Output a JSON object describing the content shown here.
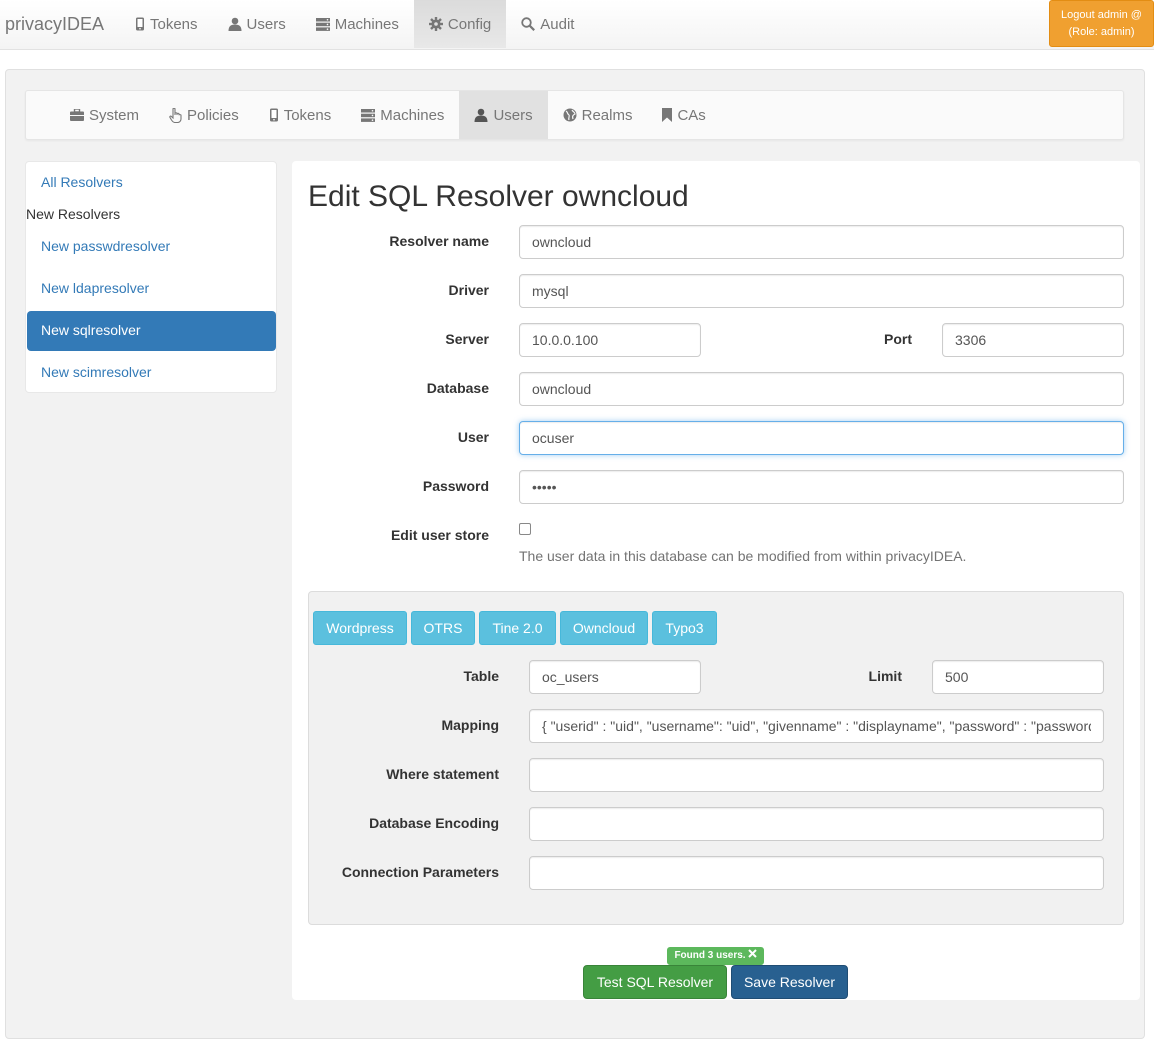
{
  "app": {
    "brand": "privacyIDEA"
  },
  "topnav": {
    "items": [
      {
        "label": "Tokens",
        "icon": "phone-icon"
      },
      {
        "label": "Users",
        "icon": "user-icon"
      },
      {
        "label": "Machines",
        "icon": "server-icon"
      },
      {
        "label": "Config",
        "icon": "gear-icon",
        "active": true
      },
      {
        "label": "Audit",
        "icon": "search-icon"
      }
    ],
    "logout_line1": "Logout admin @",
    "logout_line2": "(Role: admin)"
  },
  "subnav": {
    "items": [
      {
        "label": "System",
        "icon": "briefcase-icon"
      },
      {
        "label": "Policies",
        "icon": "hand-pointer-icon"
      },
      {
        "label": "Tokens",
        "icon": "phone-icon"
      },
      {
        "label": "Machines",
        "icon": "server-icon"
      },
      {
        "label": "Users",
        "icon": "user-icon",
        "active": true
      },
      {
        "label": "Realms",
        "icon": "globe-icon"
      },
      {
        "label": "CAs",
        "icon": "bookmark-icon"
      }
    ]
  },
  "sidebar": {
    "all_resolvers": "All Resolvers",
    "new_heading": "New Resolvers",
    "items": [
      "New passwdresolver",
      "New ldapresolver",
      "New sqlresolver",
      "New scimresolver"
    ],
    "active_index": 2
  },
  "form": {
    "title": "Edit SQL Resolver owncloud",
    "labels": {
      "resolver_name": "Resolver name",
      "driver": "Driver",
      "server": "Server",
      "port": "Port",
      "database": "Database",
      "user": "User",
      "password": "Password",
      "edit_user_store": "Edit user store"
    },
    "values": {
      "resolver_name": "owncloud",
      "driver": "mysql",
      "server": "10.0.0.100",
      "port": "3306",
      "database": "owncloud",
      "user": "ocuser",
      "password": "•••••"
    },
    "edit_user_store_checked": false,
    "edit_user_store_help": "The user data in this database can be modified from within privacyIDEA."
  },
  "presets": [
    "Wordpress",
    "OTRS",
    "Tine 2.0",
    "Owncloud",
    "Typo3"
  ],
  "advanced": {
    "labels": {
      "table": "Table",
      "limit": "Limit",
      "mapping": "Mapping",
      "where": "Where statement",
      "encoding": "Database Encoding",
      "conn_params": "Connection Parameters"
    },
    "values": {
      "table": "oc_users",
      "limit": "500",
      "mapping": "{ \"userid\" : \"uid\", \"username\": \"uid\", \"givenname\" : \"displayname\", \"password\" : \"password\"",
      "where": "",
      "encoding": "",
      "conn_params": ""
    }
  },
  "result_badge": "Found 3 users.",
  "buttons": {
    "test": "Test SQL Resolver",
    "save": "Save Resolver"
  },
  "colors": {
    "primary": "#337ab7",
    "info": "#5bc0de",
    "success": "#5cb85c",
    "warning": "#f0ad4e"
  }
}
